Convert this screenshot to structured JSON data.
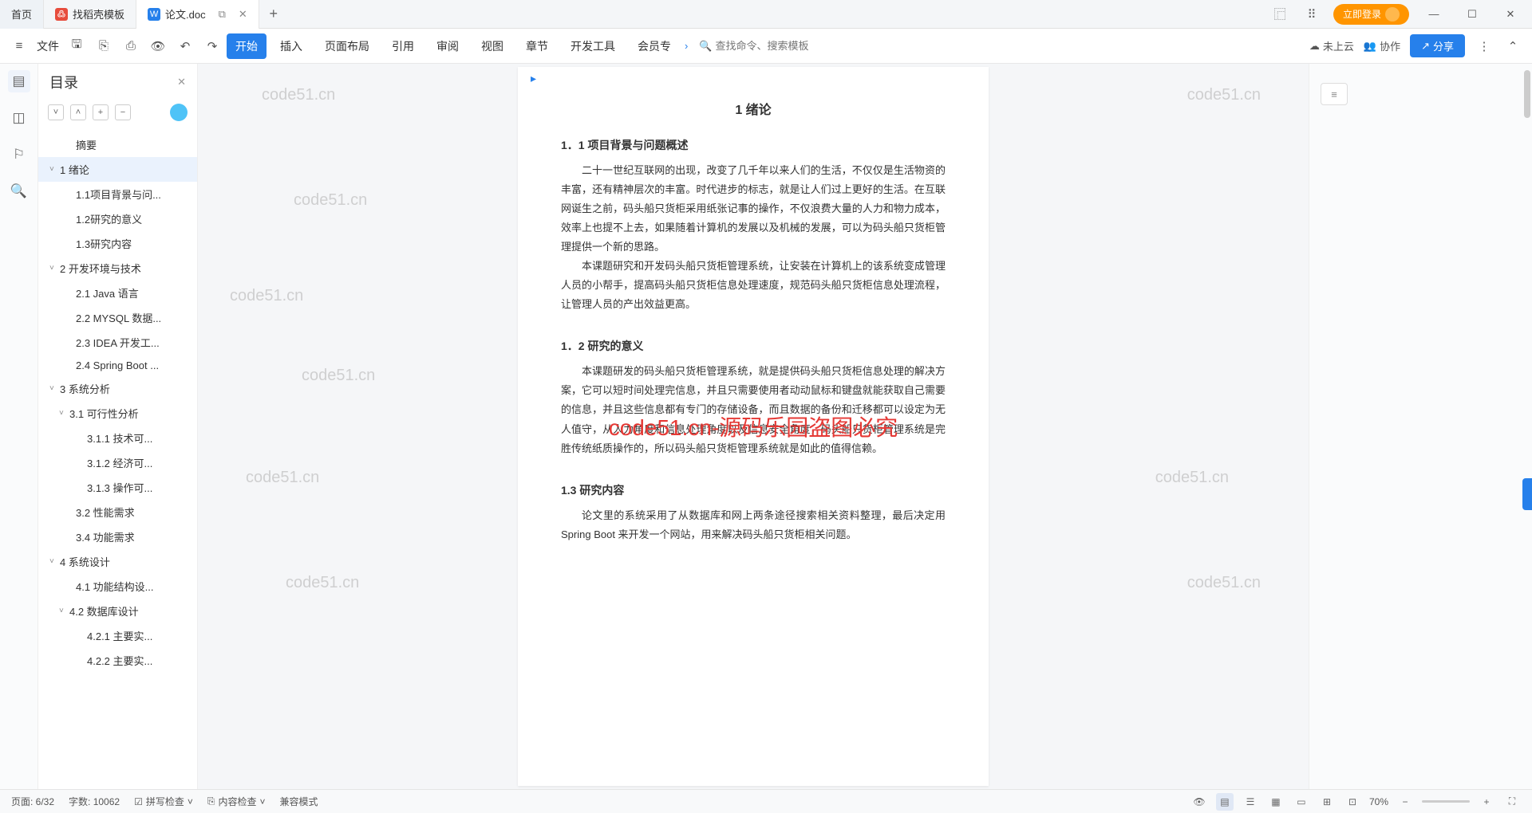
{
  "tabs": {
    "home": "首页",
    "t1": "找稻壳模板",
    "t2": "论文.doc"
  },
  "login": "立即登录",
  "ribbon": {
    "file": "文件",
    "menus": [
      "开始",
      "插入",
      "页面布局",
      "引用",
      "审阅",
      "视图",
      "章节",
      "开发工具",
      "会员专"
    ],
    "search_ph": "查找命令、搜索模板",
    "cloud": "未上云",
    "collab": "协作",
    "share": "分享"
  },
  "outline": {
    "title": "目录",
    "items": [
      {
        "t": "摘要",
        "lv": "l2",
        "c": ""
      },
      {
        "t": "1 绪论",
        "lv": "l1",
        "c": "˅",
        "active": true
      },
      {
        "t": "1.1项目背景与问...",
        "lv": "l2",
        "c": ""
      },
      {
        "t": "1.2研究的意义",
        "lv": "l2",
        "c": ""
      },
      {
        "t": "1.3研究内容",
        "lv": "l2",
        "c": ""
      },
      {
        "t": "2 开发环境与技术",
        "lv": "l1",
        "c": "˅"
      },
      {
        "t": "2.1 Java 语言",
        "lv": "l2",
        "c": ""
      },
      {
        "t": "2.2 MYSQL 数据...",
        "lv": "l2",
        "c": ""
      },
      {
        "t": "2.3 IDEA 开发工...",
        "lv": "l2",
        "c": ""
      },
      {
        "t": "2.4 Spring Boot ...",
        "lv": "l2",
        "c": ""
      },
      {
        "t": "3  系统分析",
        "lv": "l1",
        "c": "˅"
      },
      {
        "t": "3.1 可行性分析",
        "lv": "l2b",
        "c": "˅"
      },
      {
        "t": "3.1.1  技术可...",
        "lv": "l3",
        "c": ""
      },
      {
        "t": "3.1.2  经济可...",
        "lv": "l3",
        "c": ""
      },
      {
        "t": "3.1.3  操作可...",
        "lv": "l3",
        "c": ""
      },
      {
        "t": "3.2 性能需求",
        "lv": "l2",
        "c": ""
      },
      {
        "t": "3.4 功能需求",
        "lv": "l2",
        "c": ""
      },
      {
        "t": "4  系统设计",
        "lv": "l1",
        "c": "˅"
      },
      {
        "t": "4.1 功能结构设...",
        "lv": "l2",
        "c": ""
      },
      {
        "t": "4.2 数据库设计",
        "lv": "l2b",
        "c": "˅"
      },
      {
        "t": "4.2.1  主要实...",
        "lv": "l3",
        "c": ""
      },
      {
        "t": "4.2.2  主要实...",
        "lv": "l3",
        "c": ""
      }
    ]
  },
  "doc": {
    "h1": "1 绪论",
    "s11": "1．1 项目背景与问题概述",
    "p1": "二十一世纪互联网的出现，改变了几千年以来人们的生活，不仅仅是生活物资的丰富，还有精神层次的丰富。时代进步的标志，就是让人们过上更好的生活。在互联网诞生之前，码头船只货柜采用纸张记事的操作，不仅浪费大量的人力和物力成本，效率上也提不上去，如果随着计算机的发展以及机械的发展，可以为码头船只货柜管理提供一个新的思路。",
    "p2": "本课题研究和开发码头船只货柜管理系统，让安装在计算机上的该系统变成管理人员的小帮手，提高码头船只货柜信息处理速度，规范码头船只货柜信息处理流程，让管理人员的产出效益更高。",
    "s12": "1．2 研究的意义",
    "p3": "本课题研发的码头船只货柜管理系统，就是提供码头船只货柜信息处理的解决方案，它可以短时间处理完信息，并且只需要使用者动动鼠标和键盘就能获取自己需要的信息，并且这些信息都有专门的存储设备，而且数据的备份和迁移都可以设定为无人值守，从人力角度和信息处理角度以及信息安全角度，码头船只货柜管理系统是完胜传统纸质操作的，所以码头船只货柜管理系统就是如此的值得信赖。",
    "s13": "1.3  研究内容",
    "p4": "论文里的系统采用了从数据库和网上两条途径搜索相关资料整理，最后决定用Spring Boot 来开发一个网站，用来解决码头船只货柜相关问题。"
  },
  "wm": {
    "text": "code51.cn",
    "red": "code51.cn-源码乐园盗图必究"
  },
  "status": {
    "page": "页面: 6/32",
    "words": "字数: 10062",
    "spell": "拼写检查",
    "content": "内容检查",
    "compat": "兼容模式",
    "zoom": "70%"
  }
}
